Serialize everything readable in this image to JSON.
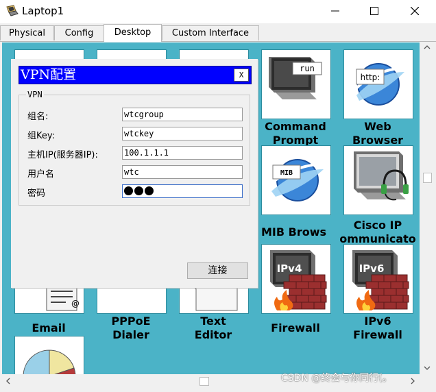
{
  "window": {
    "title": "Laptop1"
  },
  "tabs": [
    {
      "label": "Physical",
      "active": false
    },
    {
      "label": "Config",
      "active": false
    },
    {
      "label": "Desktop",
      "active": true
    },
    {
      "label": "Custom Interface",
      "active": false
    }
  ],
  "apps": {
    "command_prompt": {
      "icon_text": "run",
      "label_line1": "Command",
      "label_line2": "Prompt"
    },
    "web_browser": {
      "icon_text": "http:",
      "label_line1": "Web",
      "label_line2": "Browser"
    },
    "mib_browser": {
      "icon_text": "MIB",
      "label_line1": "MIB Brows"
    },
    "cisco_ip": {
      "label_line1": "Cisco IP",
      "label_line2": "ommunicato"
    },
    "email": {
      "label_line1": "Email"
    },
    "pppoe": {
      "label_line1": "PPPoE",
      "label_line2": "Dialer"
    },
    "text_editor": {
      "label_line1": "Text",
      "label_line2": "Editor"
    },
    "firewall": {
      "icon_text": "IPv4",
      "label_line1": "Firewall"
    },
    "ipv6_firewall": {
      "icon_text": "IPv6",
      "label_line1": "IPv6",
      "label_line2": "Firewall"
    }
  },
  "dialog": {
    "title": "VPN配置",
    "close_label": "X",
    "group_legend": "VPN",
    "fields": {
      "group_name": {
        "label": "组名:",
        "value": "wtcgroup"
      },
      "group_key": {
        "label": "组Key:",
        "value": "wtckey"
      },
      "host_ip": {
        "label": "主机IP(服务器IP):",
        "value": "100.1.1.1"
      },
      "username": {
        "label": "用户名",
        "value": "wtc"
      },
      "password": {
        "label": "密码",
        "masked_length": 3
      }
    },
    "connect_label": "连接"
  },
  "watermark": "CSDN @终会与你同行(。",
  "colors": {
    "desktop_bg": "#4bb3c7",
    "dialog_title_bg": "#0000ff",
    "firewall_brick": "#9b2f2f"
  }
}
